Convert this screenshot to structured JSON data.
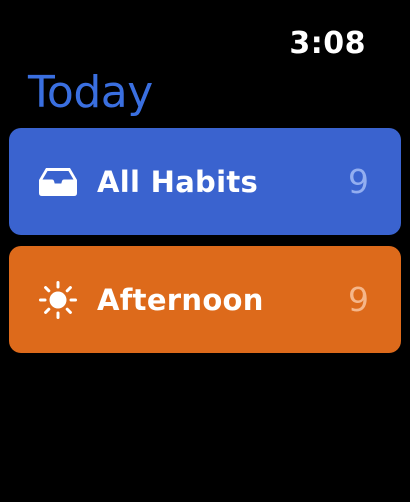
{
  "status": {
    "time": "3:08"
  },
  "header": {
    "title": "Today",
    "title_color": "#3a6fe0"
  },
  "cards": [
    {
      "label": "All Habits",
      "count": "9",
      "icon": "inbox-tray-icon",
      "background": "#3a63cf",
      "count_color": "#93aef0"
    },
    {
      "label": "Afternoon",
      "count": "9",
      "icon": "sun-icon",
      "background": "#dd6a1b",
      "count_color": "#f5b68a"
    }
  ]
}
